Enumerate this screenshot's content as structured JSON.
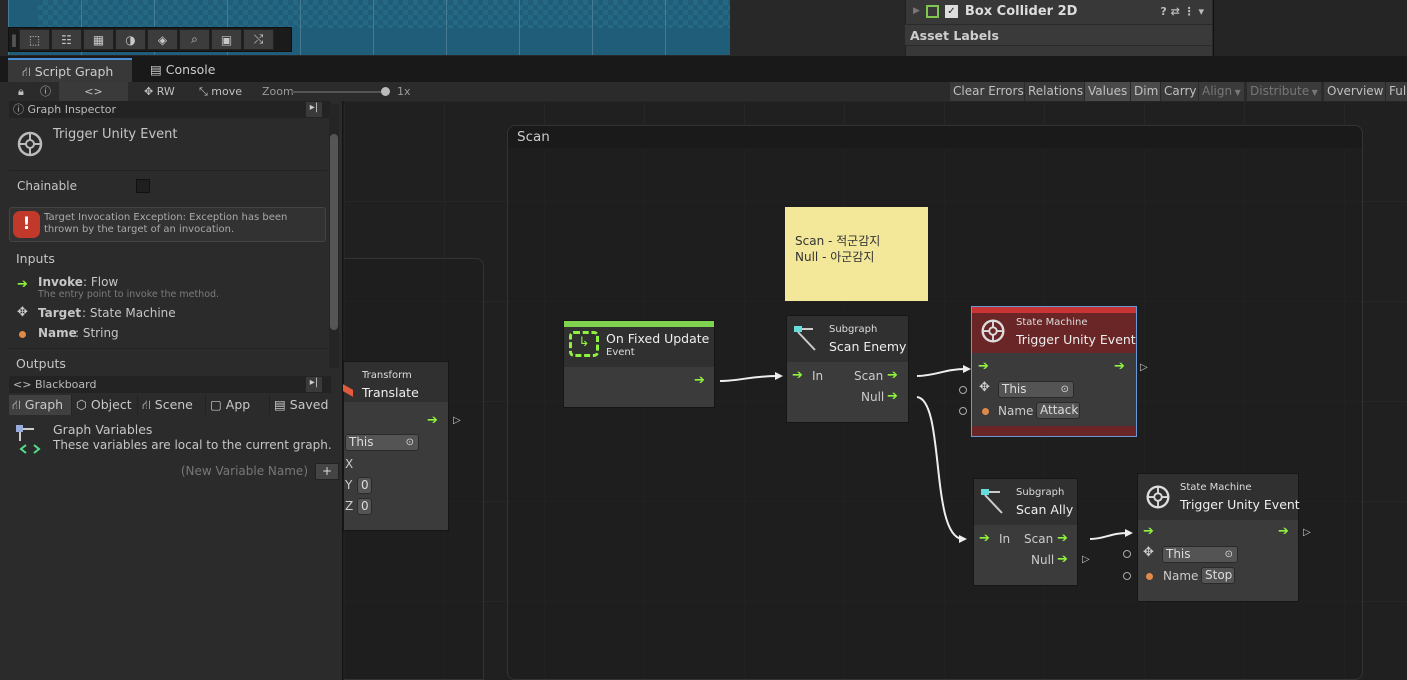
{
  "scene_toolbar": {
    "icons": [
      "rect-tool-icon",
      "layout-icon",
      "grid-icon",
      "shading-icon",
      "layers-icon",
      "search-icon",
      "camera-icon",
      "shuffle-icon"
    ]
  },
  "inspector": {
    "component": "Box Collider 2D",
    "asset_labels": "Asset Labels"
  },
  "tabs": {
    "script_graph": "Script Graph",
    "console": "Console"
  },
  "toolbar": {
    "rw": "RW",
    "move": "move",
    "zoom": "Zoom",
    "zoom_value": "1x",
    "right_buttons": [
      "Clear Errors",
      "Relations",
      "Values",
      "Dim",
      "Carry",
      "Align",
      "Distribute",
      "Overview",
      "Full"
    ]
  },
  "graph_inspector": {
    "header": "Graph Inspector",
    "title": "Trigger Unity Event",
    "chainable": "Chainable",
    "error": "Target Invocation Exception: Exception has been thrown by the target of an invocation.",
    "inputs_label": "Inputs",
    "inputs": [
      {
        "name": "Invoke",
        "type": " : Flow",
        "desc": "The entry point to invoke the method."
      },
      {
        "name": "Target",
        "type": " : State Machine"
      },
      {
        "name": "Name",
        "type": " : String"
      }
    ],
    "outputs_label": "Outputs"
  },
  "blackboard": {
    "header": "Blackboard",
    "tabs": [
      "Graph",
      "Object",
      "Scene",
      "App",
      "Saved"
    ],
    "title": "Graph Variables",
    "desc": "These variables are local to the current graph.",
    "new_var_placeholder": "(New Variable Name)",
    "add": "+"
  },
  "graph": {
    "group_title": "Scan",
    "sticky_line1": "Scan - 적군감지",
    "sticky_line2": "Null - 아군감지",
    "translate": {
      "category": "Transform",
      "title": "Translate",
      "target": "This",
      "x": "X",
      "y": "Y",
      "y_val": "0",
      "z": "Z",
      "z_val": "0"
    },
    "fixed_update": {
      "title": "On Fixed Update",
      "sub": "Event"
    },
    "scan_enemy": {
      "category": "Subgraph",
      "title": "Scan Enemy",
      "in": "In",
      "scan": "Scan",
      "null": "Null"
    },
    "scan_ally": {
      "category": "Subgraph",
      "title": "Scan Ally",
      "in": "In",
      "scan": "Scan",
      "null": "Null"
    },
    "trigger_attack": {
      "category": "State Machine",
      "title": "Trigger Unity Event",
      "this": "This",
      "name_label": "Name",
      "name_value": "Attack"
    },
    "trigger_stop": {
      "category": "State Machine",
      "title": "Trigger Unity Event",
      "this": "This",
      "name_label": "Name",
      "name_value": "Stop"
    }
  }
}
